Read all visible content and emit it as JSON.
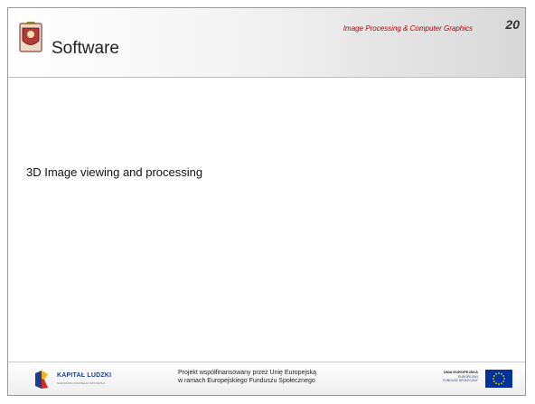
{
  "header": {
    "title": "Software",
    "course": "Image Processing & Computer Graphics",
    "slide_number": "20"
  },
  "content": {
    "line": "3D Image viewing and processing"
  },
  "footer": {
    "kl_name": "KAPITAŁ LUDZKI",
    "kl_sub": "NARODOWA STRATEGIA SPÓJNOŚCI",
    "project_line1": "Projekt współfinansowany przez Unię Europejską",
    "project_line2": "w ramach Europejskiego Funduszu Społecznego",
    "eu_line1": "UNIA EUROPEJSKA",
    "eu_line2": "EUROPEJSKI",
    "eu_line3": "FUNDUSZ SPOŁECZNY"
  },
  "colors": {
    "course_text": "#b00000",
    "kl_blue": "#1a3f8f",
    "eu_flag": "#003399",
    "eu_stars": "#ffcc00"
  },
  "icons": {
    "crest": "university-crest-icon",
    "kl_logo": "kapital-ludzki-logo-icon",
    "eu_flag": "eu-flag-icon"
  }
}
